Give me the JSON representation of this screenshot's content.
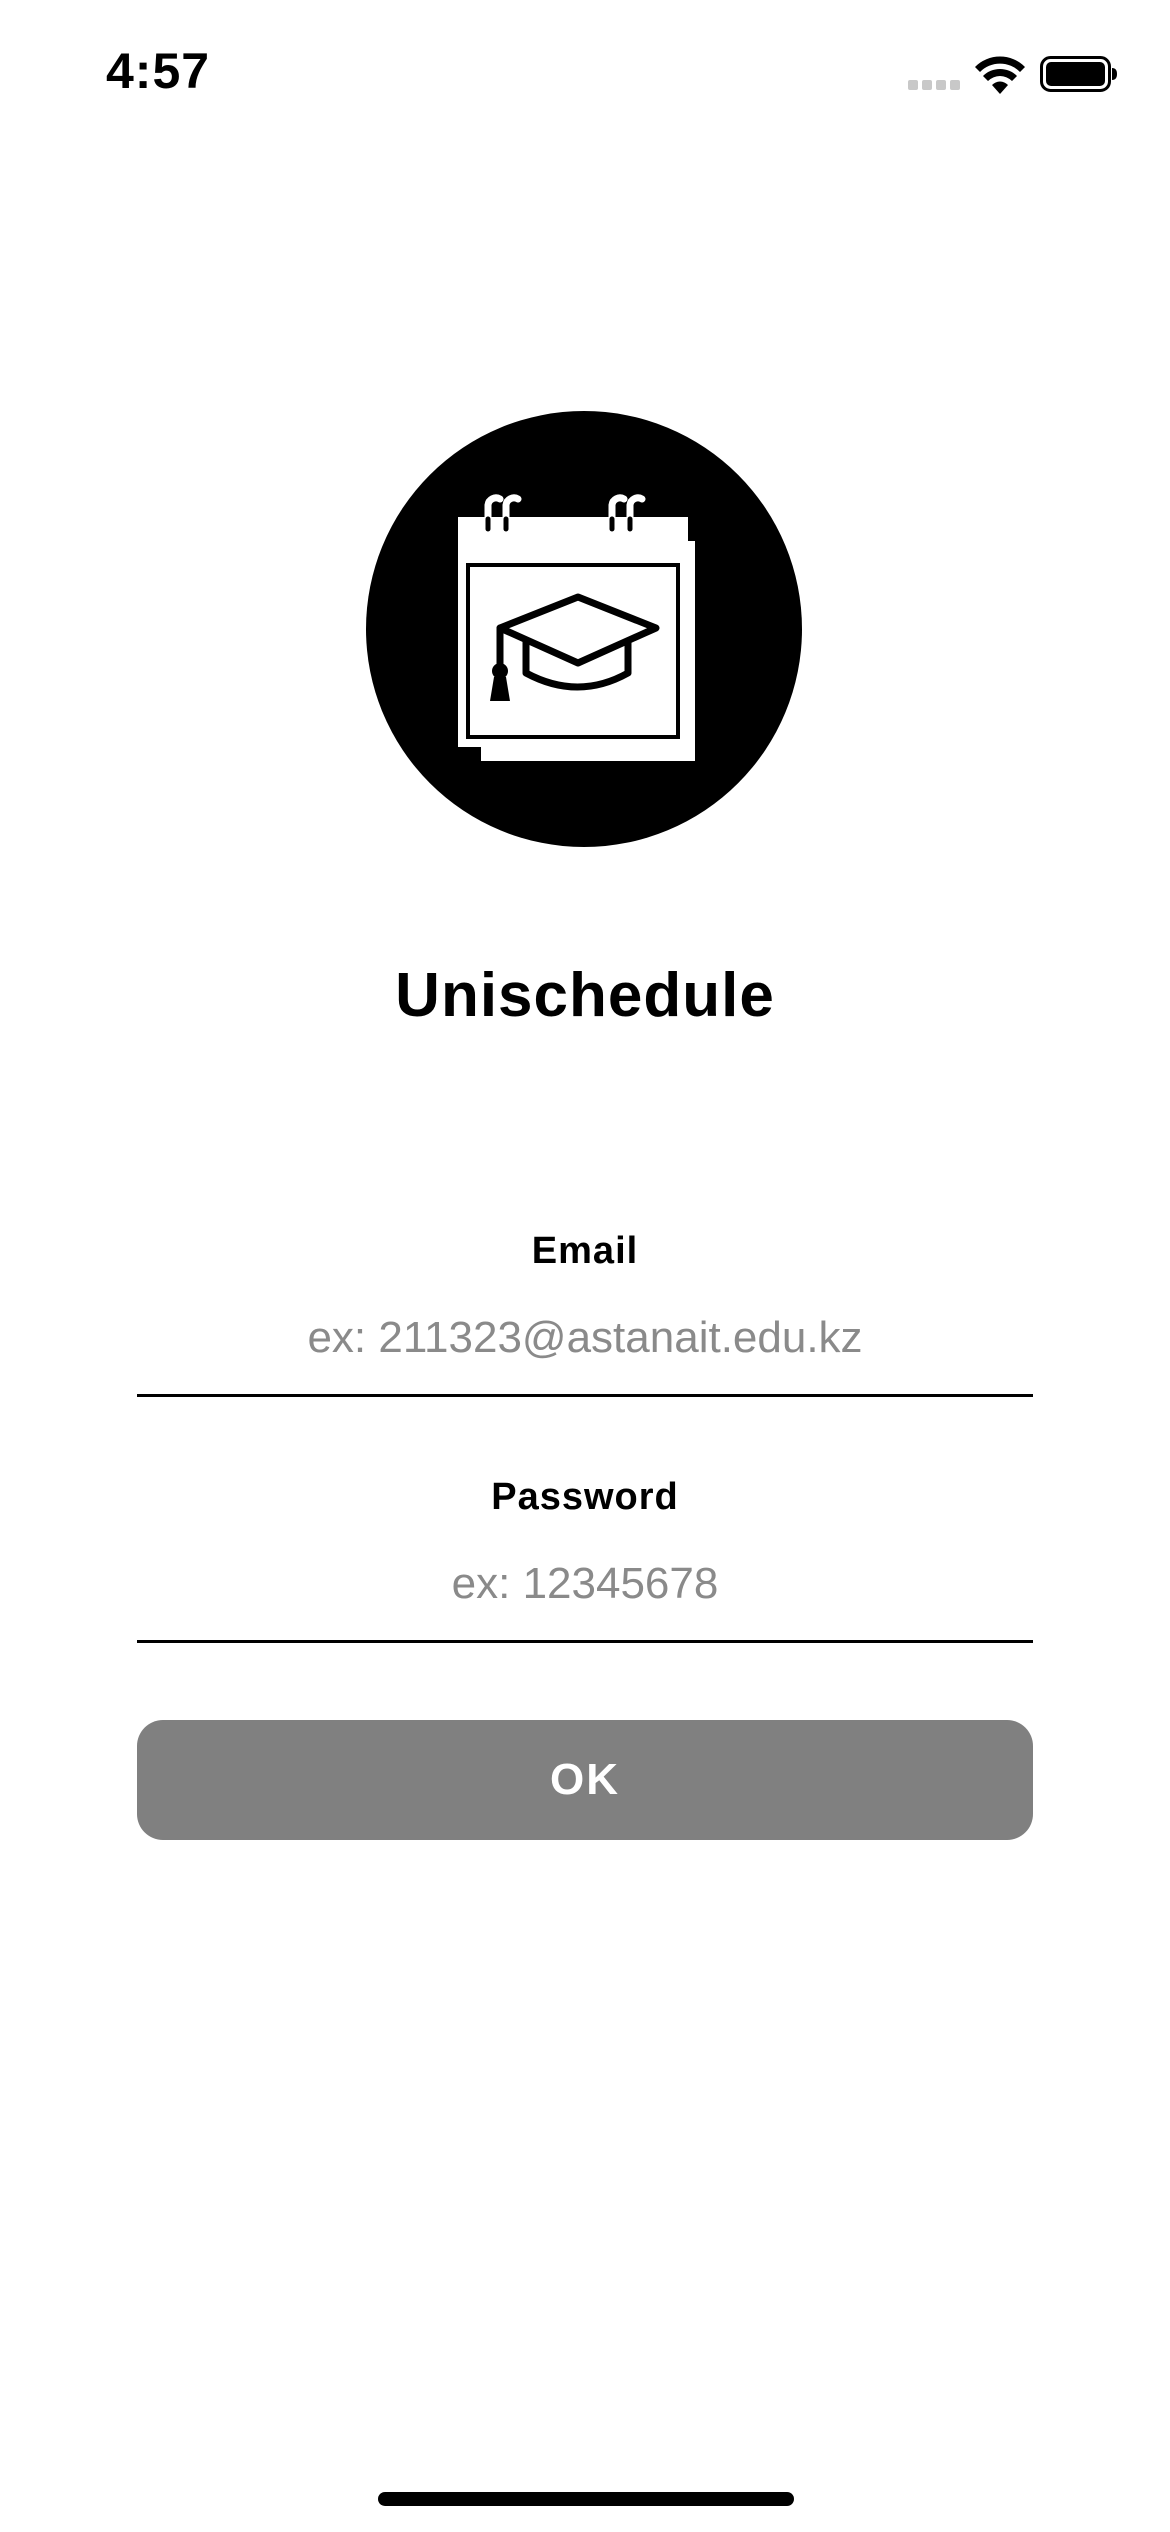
{
  "status_bar": {
    "time": "4:57",
    "icons": [
      "cellular-signal-icon",
      "wifi-icon",
      "battery-icon"
    ]
  },
  "app": {
    "logo_icon": "calendar-graduation-cap-icon",
    "title": "Unischedule"
  },
  "form": {
    "email": {
      "label": "Email",
      "value": "",
      "placeholder": "ex: 211323@astanait.edu.kz"
    },
    "password": {
      "label": "Password",
      "value": "",
      "placeholder": "ex: 12345678"
    },
    "submit_label": "OK"
  },
  "colors": {
    "background": "#ffffff",
    "text": "#000000",
    "placeholder": "#8a8a8a",
    "button_background": "#808080",
    "button_text": "#ffffff"
  }
}
